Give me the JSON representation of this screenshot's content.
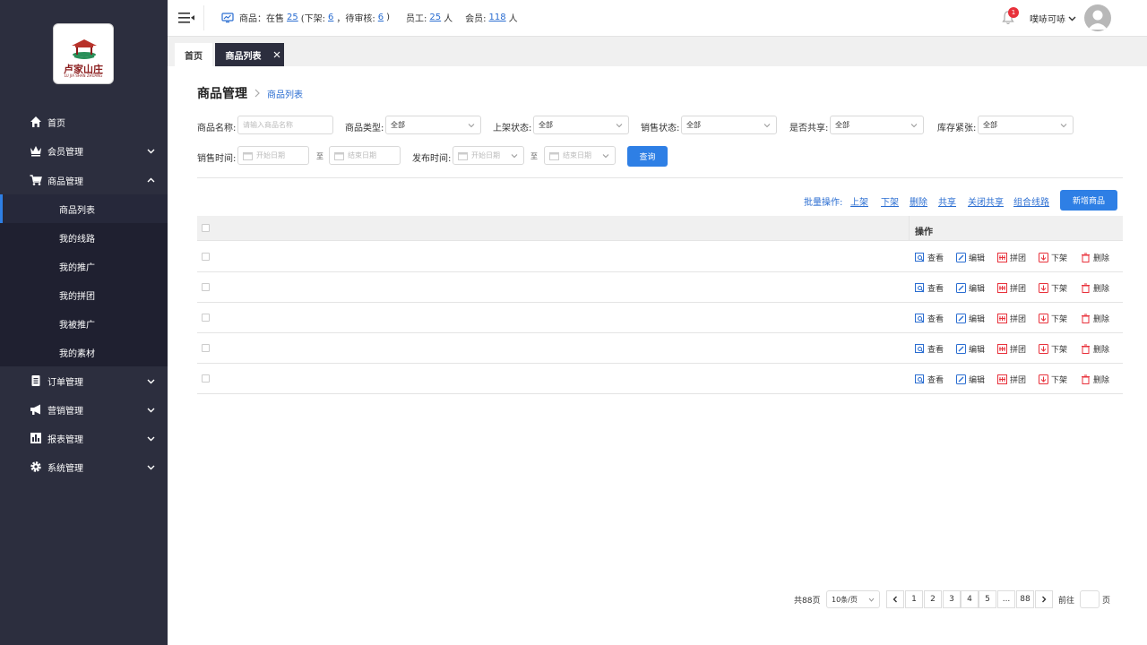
{
  "logo": {
    "text": "卢家山庄",
    "sub": "LU JIA SHAN ZHUANG"
  },
  "sidebar": {
    "items": [
      {
        "label": "首页",
        "icon": "home-icon"
      },
      {
        "label": "会员管理",
        "icon": "crown-icon"
      },
      {
        "label": "商品管理",
        "icon": "cart-icon"
      },
      {
        "label": "订单管理",
        "icon": "document-icon"
      },
      {
        "label": "营销管理",
        "icon": "megaphone-icon"
      },
      {
        "label": "报表管理",
        "icon": "bar-chart-icon"
      },
      {
        "label": "系统管理",
        "icon": "gear-icon"
      }
    ],
    "subitems": [
      "商品列表",
      "我的线路",
      "我的推广",
      "我的拼团",
      "我被推广",
      "我的素材"
    ]
  },
  "topbar": {
    "goods_label": "商品：在售",
    "on_sale": "25",
    "off_label": "(下架:",
    "off_shelf": "6",
    "pending_label": "，待审核:",
    "pending": "6",
    "close_paren": ")",
    "staff_label": "员工:",
    "staff": "25",
    "staff_unit": "人",
    "member_label": "会员:",
    "members": "118",
    "member_unit": "人",
    "notifications": "1",
    "username": "噗哧可哧"
  },
  "tabs": {
    "home": "首页",
    "current": "商品列表"
  },
  "breadcrumb": {
    "title": "商品管理",
    "current": "商品列表"
  },
  "filters": {
    "name_label": "商品名称:",
    "name_placeholder": "请输入商品名称",
    "type_label": "商品类型:",
    "type_value": "全部",
    "shelf_label": "上架状态:",
    "shelf_value": "全部",
    "sale_label": "销售状态:",
    "sale_value": "全部",
    "share_label": "是否共享:",
    "share_value": "全部",
    "stock_label": "库存紧张:",
    "stock_value": "全部",
    "sale_time_label": "销售时间:",
    "start_placeholder": "开始日期",
    "to": "至",
    "end_placeholder": "结束日期",
    "publish_time_label": "发布时间:",
    "query": "查询"
  },
  "batch": {
    "label": "批量操作:",
    "actions": [
      "上架",
      "下架",
      "删除",
      "共享",
      "关闭共享",
      "组合线路"
    ],
    "new_button": "新增商品"
  },
  "table": {
    "op_header": "操作",
    "actions": [
      "查看",
      "编辑",
      "拼团",
      "下架",
      "删除"
    ],
    "row_count": 5
  },
  "pagination": {
    "total": "共88页",
    "page_size": "10条/页",
    "pages": [
      "1",
      "2",
      "3",
      "4",
      "5",
      "...",
      "88"
    ],
    "goto_label": "前往",
    "page_unit": "页"
  },
  "colors": {
    "sidebar": "#2c2e3e",
    "accent": "#2e7fe5",
    "link": "#2a6dd1",
    "danger": "#e8313b"
  }
}
